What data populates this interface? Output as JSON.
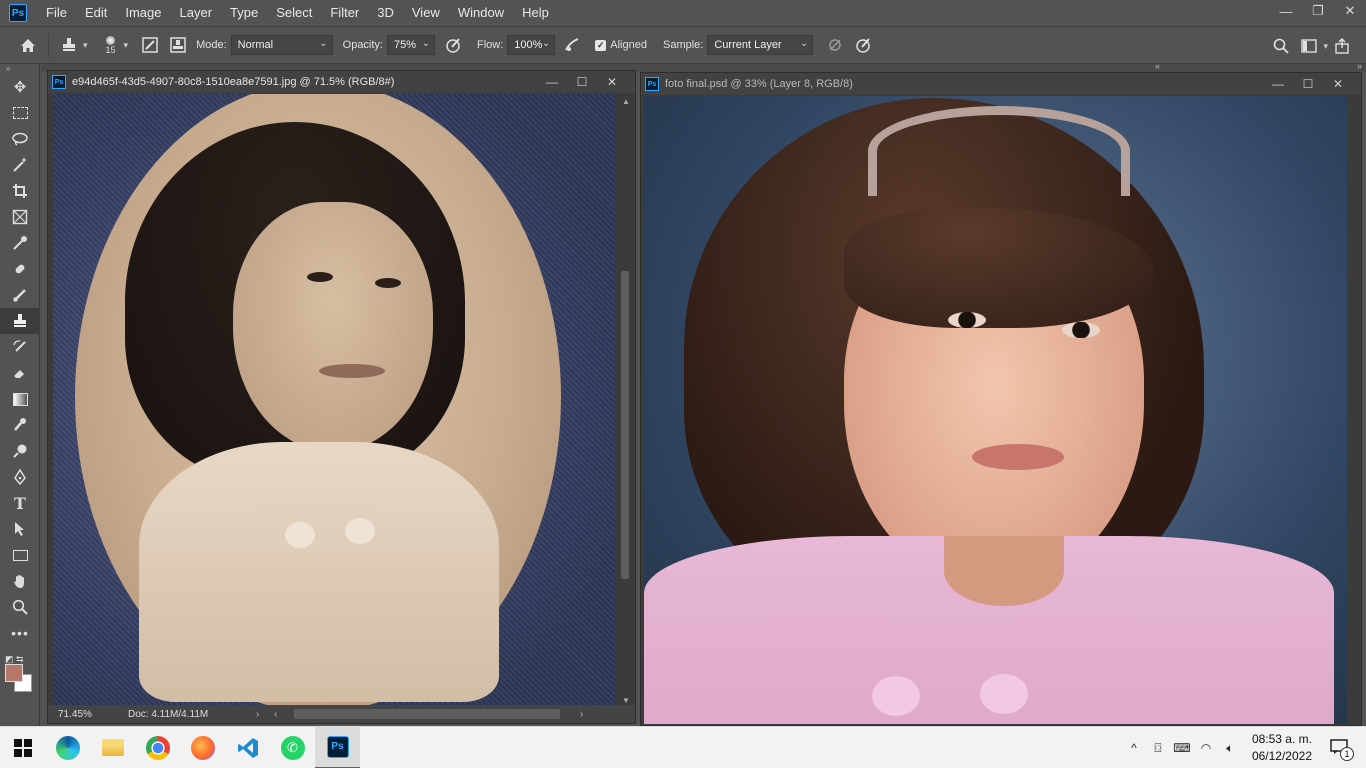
{
  "app": {
    "logo": "Ps"
  },
  "menu": [
    "File",
    "Edit",
    "Image",
    "Layer",
    "Type",
    "Select",
    "Filter",
    "3D",
    "View",
    "Window",
    "Help"
  ],
  "window_controls": {
    "minimize": "—",
    "restore": "❐",
    "close": "✕"
  },
  "options": {
    "brush_size": "15",
    "mode_label": "Mode:",
    "mode_value": "Normal",
    "opacity_label": "Opacity:",
    "opacity_value": "75%",
    "flow_label": "Flow:",
    "flow_value": "100%",
    "aligned_label": "Aligned",
    "aligned_checked": true,
    "sample_label": "Sample:",
    "sample_value": "Current Layer"
  },
  "tools": [
    "move-icon",
    "marquee-icon",
    "lasso-icon",
    "magic-wand-icon",
    "crop-icon",
    "frame-icon",
    "eyedropper-icon",
    "healing-icon",
    "brush-icon",
    "clone-stamp-icon",
    "history-brush-icon",
    "eraser-icon",
    "gradient-icon",
    "smudge-icon",
    "dodge-icon",
    "pen-icon",
    "type-icon",
    "path-select-icon",
    "rectangle-icon",
    "hand-icon",
    "zoom-icon",
    "more-icon"
  ],
  "colors": {
    "foreground": "#b7766a",
    "background": "#ffffff",
    "accent": "#31a8ff"
  },
  "doc_left": {
    "title": "e94d465f-43d5-4907-80c8-1510ea8e7591.jpg @ 71.5% (RGB/8#)",
    "zoom": "71.45%",
    "doc_info": "Doc: 4.11M/4.11M"
  },
  "doc_right": {
    "title": "foto final.psd @ 33% (Layer 8, RGB/8)"
  },
  "taskbar": {
    "apps": [
      "windows-start-icon",
      "edge-icon",
      "file-explorer-icon",
      "chrome-icon",
      "firefox-icon",
      "vscode-icon",
      "whatsapp-icon",
      "photoshop-icon"
    ],
    "clock_time": "08:53 a. m.",
    "clock_date": "06/12/2022",
    "notification_count": "1"
  }
}
